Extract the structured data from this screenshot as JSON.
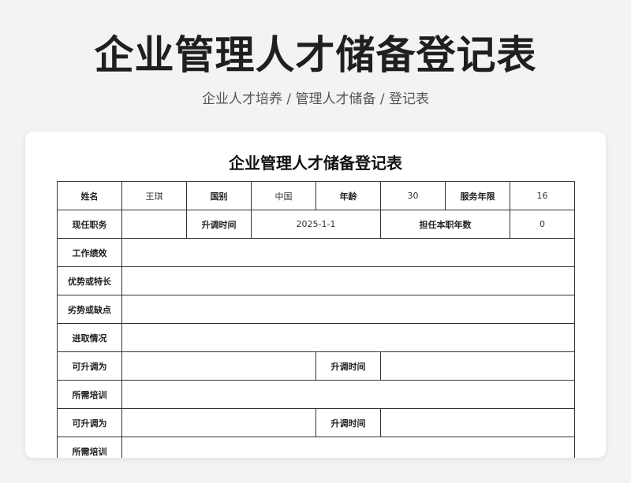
{
  "header": {
    "title": "企业管理人才储备登记表",
    "breadcrumb": "企业人才培养 / 管理人才储备 / 登记表"
  },
  "form": {
    "title": "企业管理人才储备登记表",
    "labels": {
      "name": "姓名",
      "nationality": "国别",
      "age": "年龄",
      "service_years": "服务年限",
      "current_position": "现任职务",
      "promotion_time": "升调时间",
      "years_in_position": "担任本职年数",
      "performance": "工作绩效",
      "strengths": "优势或特长",
      "weaknesses": "劣势或缺点",
      "initiative": "进取情况",
      "promotable_to": "可升调为",
      "training_needed": "所需培训"
    },
    "values": {
      "name": "王琪",
      "nationality": "中国",
      "age": "30",
      "service_years": "16",
      "current_position": "",
      "promotion_time": "2025-1-1",
      "years_in_position": "0",
      "performance": "",
      "strengths": "",
      "weaknesses": "",
      "initiative": "",
      "promotable_to_1": "",
      "promotion_time_1": "",
      "training_needed_1": "",
      "promotable_to_2": "",
      "promotion_time_2": "",
      "training_needed_2": ""
    }
  }
}
